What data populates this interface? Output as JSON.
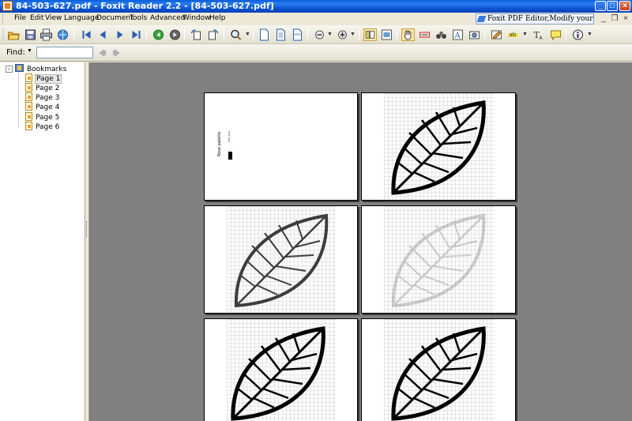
{
  "window": {
    "title": "84-503-627.pdf - Foxit Reader 2.2 - [84-503-627.pdf]",
    "controls": {
      "minimize": "_",
      "maximize": "□",
      "close": "×"
    }
  },
  "menu": {
    "items": [
      "File",
      "Edit",
      "View",
      "Language",
      "Document",
      "Tools",
      "Advanced",
      "Window",
      "Help"
    ],
    "promo": "Foxit PDF Editor,Modify your PDF!",
    "inner_controls": {
      "minimize": "_",
      "restore": "❐",
      "close": "×"
    }
  },
  "findbar": {
    "label": "Find:",
    "value": ""
  },
  "sidebar": {
    "root": "Bookmarks",
    "expander": "-",
    "items": [
      "Page 1",
      "Page 2",
      "Page 3",
      "Page 4",
      "Page 5",
      "Page 6"
    ],
    "selected": "Page 1"
  },
  "document": {
    "page1_title": "Rose palette",
    "page1_small": "DMC 3021"
  },
  "colors": {
    "titlebar": "#0a5fd8",
    "chrome": "#ece9d8",
    "doc_background": "#808080"
  }
}
